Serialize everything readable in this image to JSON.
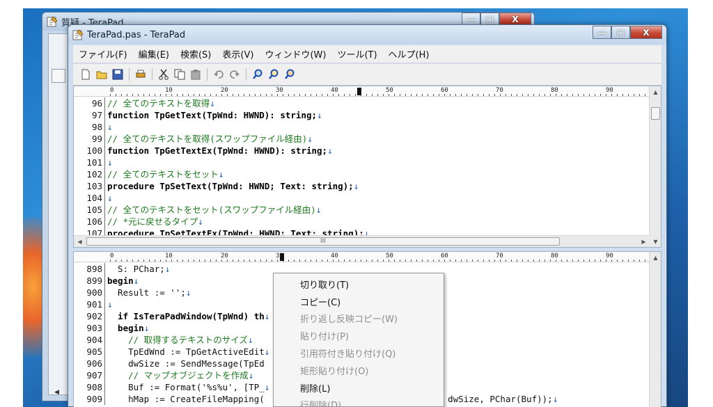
{
  "back_window": {
    "title": "質疑 - TeraPad",
    "menu_hint": "フ"
  },
  "window": {
    "title": "TeraPad.pas - TeraPad",
    "caption_buttons": {
      "minimize": "—",
      "maximize": "□",
      "close": "X"
    }
  },
  "menubar": [
    {
      "label": "ファイル(F)"
    },
    {
      "label": "編集(E)"
    },
    {
      "label": "検索(S)"
    },
    {
      "label": "表示(V)"
    },
    {
      "label": "ウィンドウ(W)"
    },
    {
      "label": "ツール(T)"
    },
    {
      "label": "ヘルプ(H)"
    }
  ],
  "toolbar_icons": [
    "new-file-icon",
    "open-folder-icon",
    "save-icon",
    "print-icon",
    "cut-icon",
    "copy-icon",
    "paste-icon",
    "undo-icon",
    "redo-icon",
    "find-icon",
    "find-next-icon",
    "find-prev-icon"
  ],
  "ruler": {
    "labels": [
      "0",
      "10",
      "20",
      "30",
      "40",
      "50",
      "60",
      "70",
      "80",
      "90"
    ]
  },
  "top_pane": {
    "lines": [
      {
        "num": "96",
        "text": "// 全てのテキストを取得",
        "style": "comment"
      },
      {
        "num": "97",
        "text": "function TpGetText(TpWnd: HWND): string;",
        "style": "kw"
      },
      {
        "num": "98",
        "text": "",
        "style": "plain"
      },
      {
        "num": "99",
        "text": "// 全てのテキストを取得(スワップファイル経由)",
        "style": "comment"
      },
      {
        "num": "100",
        "text": "function TpGetTextEx(TpWnd: HWND): string;",
        "style": "kw"
      },
      {
        "num": "101",
        "text": "",
        "style": "plain"
      },
      {
        "num": "102",
        "text": "// 全てのテキストをセット",
        "style": "comment"
      },
      {
        "num": "103",
        "text": "procedure TpSetText(TpWnd: HWND; Text: string);",
        "style": "kw"
      },
      {
        "num": "104",
        "text": "",
        "style": "plain"
      },
      {
        "num": "105",
        "text": "// 全てのテキストをセット(スワップファイル経由)",
        "style": "comment"
      },
      {
        "num": "106",
        "text": "// *元に戻せるタイプ",
        "style": "comment"
      },
      {
        "num": "107",
        "text": "procedure TpSetTextEx(TpWnd: HWND; Text: string);",
        "style": "kw"
      }
    ],
    "hscroll_grip": "III"
  },
  "bottom_pane": {
    "lines": [
      {
        "num": "898",
        "text": "  S: PChar;",
        "style": "plain"
      },
      {
        "num": "899",
        "text": "begin",
        "style": "kw"
      },
      {
        "num": "900",
        "text": "  Result := '';",
        "style": "plain"
      },
      {
        "num": "901",
        "text": "",
        "style": "plain"
      },
      {
        "num": "902",
        "text": "  if IsTeraPadWindow(TpWnd) th",
        "style": "kw"
      },
      {
        "num": "903",
        "text": "  begin",
        "style": "kw"
      },
      {
        "num": "904",
        "text": "    // 取得するテキストのサイズ",
        "style": "comment"
      },
      {
        "num": "905",
        "text": "    TpEdWnd := TpGetActiveEdit",
        "style": "plain"
      },
      {
        "num": "906",
        "text": "    dwSize := SendMessage(TpEd                         1;",
        "style": "plain"
      },
      {
        "num": "907",
        "text": "    // マップオブジェクトを作成",
        "style": "comment"
      },
      {
        "num": "908",
        "text": "    Buf := Format('%s%u', [TP_",
        "style": "plain"
      },
      {
        "num": "909",
        "text": "    hMap := CreateFileMapping(                    _READWRITE, 0, dwSize, PChar(Buf));",
        "style": "plain"
      }
    ]
  },
  "context_menu": [
    {
      "label": "切り取り(T)",
      "enabled": true
    },
    {
      "label": "コピー(C)",
      "enabled": true
    },
    {
      "label": "折り返し反映コピー(W)",
      "enabled": false
    },
    {
      "label": "貼り付け(P)",
      "enabled": false
    },
    {
      "label": "引用符付き貼り付け(Q)",
      "enabled": false
    },
    {
      "label": "矩形貼り付け(O)",
      "enabled": false
    },
    {
      "label": "削除(L)",
      "enabled": true
    },
    {
      "label": "行削除(D)",
      "enabled": false
    }
  ],
  "colors": {
    "comment": "#1d7a1d",
    "keyword": "#000000",
    "line_end_mark": "#1f5eb5"
  }
}
